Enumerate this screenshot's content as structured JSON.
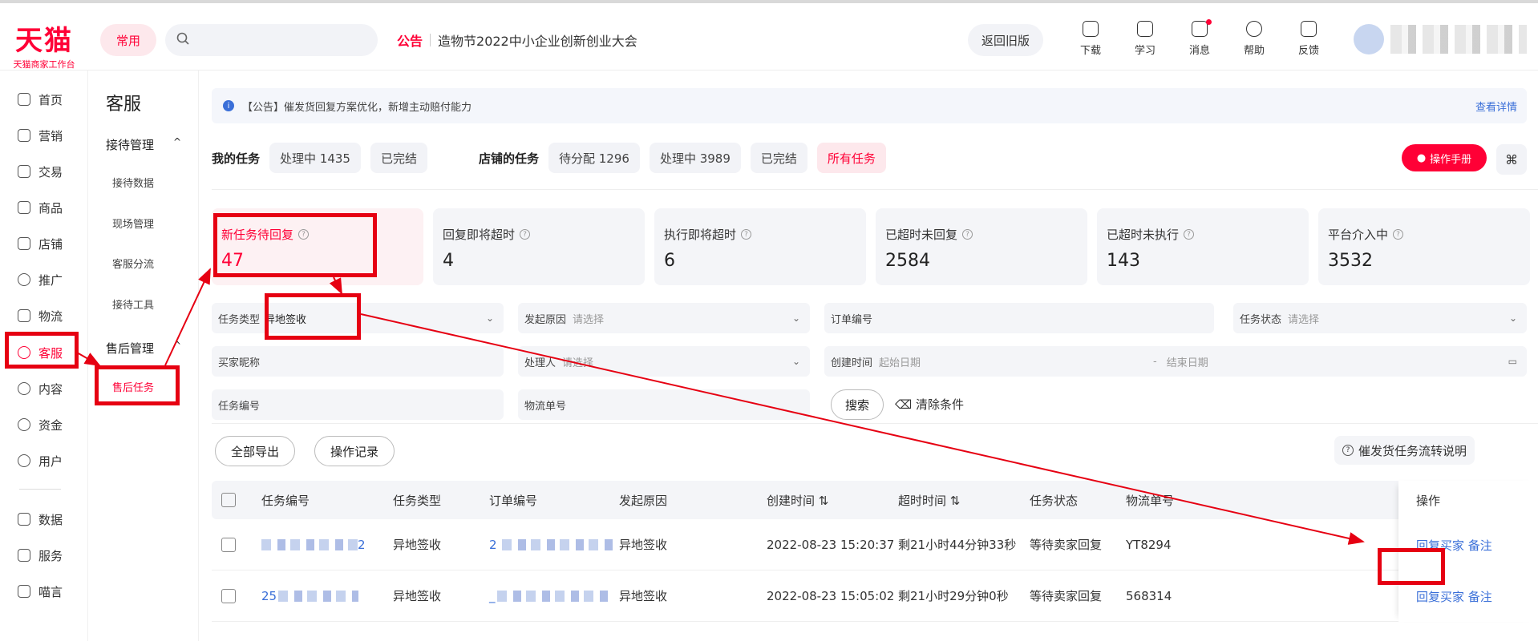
{
  "header": {
    "logo_brand": "天猫",
    "logo_sub": "天猫商家工作台",
    "common_label": "常用",
    "search_placeholder": "",
    "notice_tag": "公告",
    "notice_text": "造物节2022中小企业创新创业大会",
    "old_version_label": "返回旧版",
    "tools": [
      {
        "icon": "download-icon",
        "label": "下载"
      },
      {
        "icon": "learn-icon",
        "label": "学习"
      },
      {
        "icon": "message-icon",
        "label": "消息"
      },
      {
        "icon": "help-icon",
        "label": "帮助"
      },
      {
        "icon": "feedback-icon",
        "label": "反馈"
      }
    ]
  },
  "leftnav": [
    {
      "icon": "home-icon",
      "label": "首页"
    },
    {
      "icon": "marketing-icon",
      "label": "营销"
    },
    {
      "icon": "trade-icon",
      "label": "交易"
    },
    {
      "icon": "goods-icon",
      "label": "商品"
    },
    {
      "icon": "store-icon",
      "label": "店铺"
    },
    {
      "icon": "promotion-icon",
      "label": "推广"
    },
    {
      "icon": "logistics-icon",
      "label": "物流"
    },
    {
      "icon": "service-icon",
      "label": "客服",
      "active": true
    },
    {
      "icon": "content-icon",
      "label": "内容"
    },
    {
      "icon": "funds-icon",
      "label": "资金"
    },
    {
      "icon": "user-icon",
      "label": "用户"
    },
    {
      "icon": "data-icon",
      "label": "数据"
    },
    {
      "icon": "services-icon",
      "label": "服务"
    },
    {
      "icon": "forum-icon",
      "label": "喵言"
    }
  ],
  "subnav": {
    "title": "客服",
    "group1": "接待管理",
    "group1_items": [
      "接待数据",
      "现场管理",
      "客服分流",
      "接待工具"
    ],
    "group2": "售后管理",
    "group2_items": [
      "售后任务"
    ]
  },
  "announce": {
    "text": "【公告】催发货回复方案优化，新增主动赔付能力",
    "more": "查看详情"
  },
  "tasks": {
    "my_label": "我的任务",
    "my_chips": [
      "处理中 1435",
      "已完结"
    ],
    "shop_label": "店铺的任务",
    "shop_chips": [
      "待分配 1296",
      "处理中 3989",
      "已完结",
      "所有任务"
    ],
    "manual_btn": "操作手册"
  },
  "stats": [
    {
      "title": "新任务待回复",
      "value": "47"
    },
    {
      "title": "回复即将超时",
      "value": "4"
    },
    {
      "title": "执行即将超时",
      "value": "6"
    },
    {
      "title": "已超时未回复",
      "value": "2584"
    },
    {
      "title": "已超时未执行",
      "value": "143"
    },
    {
      "title": "平台介入中",
      "value": "3532"
    }
  ],
  "filters": {
    "task_type_label": "任务类型",
    "task_type_value": "异地签收",
    "reason_label": "发起原因",
    "reason_ph": "请选择",
    "order_no_label": "订单编号",
    "status_label": "任务状态",
    "status_ph": "请选择",
    "buyer_label": "买家昵称",
    "handler_label": "处理人",
    "handler_ph": "请选择",
    "created_label": "创建时间",
    "start_ph": "起始日期",
    "end_ph": "结束日期",
    "task_no_label": "任务编号",
    "logistics_no_label": "物流单号",
    "search_btn": "搜索",
    "clear_btn": "清除条件"
  },
  "actions": {
    "export_btn": "全部导出",
    "log_btn": "操作记录",
    "flow_link": "催发货任务流转说明"
  },
  "table": {
    "headers": [
      "任务编号",
      "任务类型",
      "订单编号",
      "发起原因",
      "创建时间",
      "超时时间",
      "任务状态",
      "物流单号",
      "操作"
    ],
    "rows": [
      {
        "task_no": "2",
        "type": "异地签收",
        "order_no": "2",
        "reason": "异地签收",
        "created": "2022-08-23 15:20:37",
        "timeout": "剩21小时44分钟33秒",
        "status": "等待卖家回复",
        "logistics": "YT8294",
        "op1": "回复买家",
        "op2": "备注"
      },
      {
        "task_no": "25",
        "type": "异地签收",
        "order_no": "_",
        "reason": "异地签收",
        "created": "2022-08-23 15:05:02",
        "timeout": "剩21小时29分钟0秒",
        "status": "等待卖家回复",
        "logistics": "568314",
        "op1": "回复买家",
        "op2": "备注"
      }
    ]
  }
}
